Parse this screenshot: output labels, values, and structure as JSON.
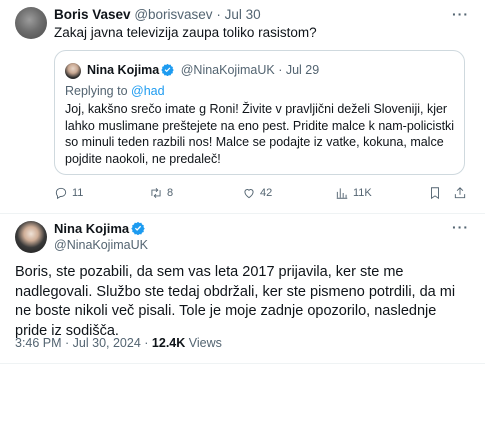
{
  "tweet": {
    "author_name": "Boris Vasev",
    "author_handle": "@borisvasev",
    "separator": "·",
    "date": "Jul 30",
    "text": "Zakaj javna televizija zaupa toliko rasistom?",
    "quote": {
      "author_name": "Nina Kojima",
      "author_handle": "@NinaKojimaUK",
      "separator": "·",
      "date": "Jul 29",
      "replying_label": "Replying to",
      "replying_handle": "@had",
      "text": "Joj, kakšno srečo imate g Roni! Živite v pravljični deželi Sloveniji, kjer lahko muslimane preštejete na eno pest. Pridite malce k nam-policistki so minuli teden razbili nos! Malce se podajte iz vatke, kokuna, malce pojdite naokoli, ne predaleč!"
    },
    "actions": {
      "replies": "11",
      "retweets": "8",
      "likes": "42",
      "views": "11K"
    }
  },
  "reply": {
    "author_name": "Nina Kojima",
    "author_handle": "@NinaKojimaUK",
    "text": "Boris, ste pozabili, da sem vas leta 2017 prijavila, ker ste me nadlegovali. Službo ste tedaj obdržali, ker ste pismeno potrdili, da mi ne boste nikoli več pisali. Tole je moje zadnje opozorilo, naslednje pride iz sodišča.",
    "timestamp": "3:46 PM · Jul 30, 2024",
    "separator": "·",
    "views_count": "12.4K",
    "views_label": "Views"
  },
  "icons": {
    "more": "more-dots-icon",
    "verified": "verified-badge-icon",
    "reply": "reply-icon",
    "retweet": "retweet-icon",
    "like": "heart-icon",
    "views": "views-icon",
    "bookmark": "bookmark-icon",
    "share": "share-icon"
  },
  "colors": {
    "accent": "#1d9bf0",
    "muted": "#536471",
    "text": "#0f1419",
    "border": "#cfd9de"
  }
}
